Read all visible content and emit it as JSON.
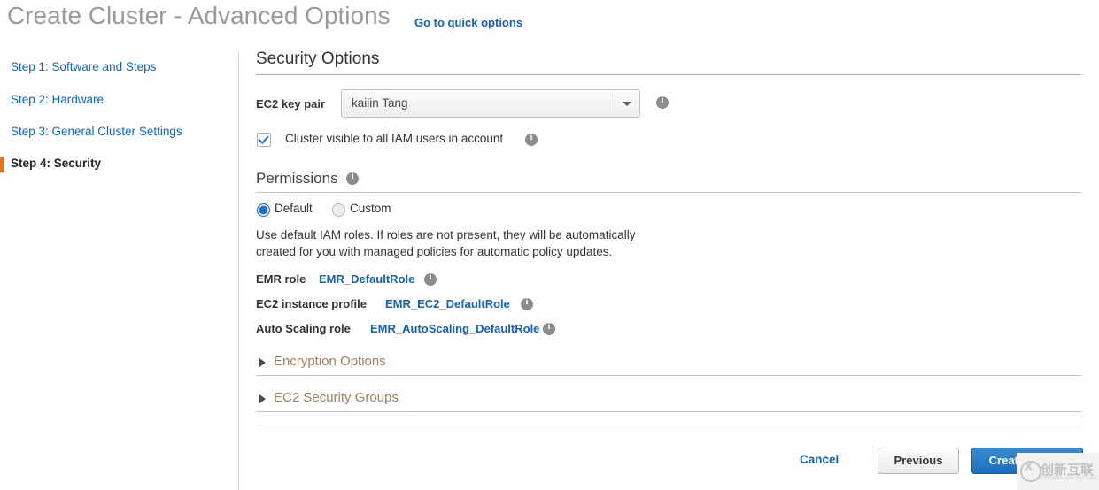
{
  "header": {
    "title": "Create Cluster - Advanced Options",
    "quick_options_link": "Go to quick options"
  },
  "sidebar": {
    "steps": [
      {
        "label": "Step 1: Software and Steps",
        "active": false
      },
      {
        "label": "Step 2: Hardware",
        "active": false
      },
      {
        "label": "Step 3: General Cluster Settings",
        "active": false
      },
      {
        "label": "Step 4: Security",
        "active": true
      }
    ],
    "active_marker_color": "#ec7211"
  },
  "main": {
    "section_title": "Security Options",
    "keypair": {
      "label": "EC2 key pair",
      "value": "kailin Tang",
      "options": [
        "kailin Tang"
      ]
    },
    "iam_visible": {
      "label": "Cluster visible to all IAM users in account",
      "checked": true
    },
    "permissions": {
      "title": "Permissions",
      "options": [
        {
          "label": "Default",
          "selected": true
        },
        {
          "label": "Custom",
          "selected": false
        }
      ],
      "description": "Use default IAM roles. If roles are not present, they will be automatically created for you with managed policies for automatic policy updates."
    },
    "roles": [
      {
        "label": "EMR role",
        "link": "EMR_DefaultRole"
      },
      {
        "label": "EC2 instance profile",
        "link": "EMR_EC2_DefaultRole"
      },
      {
        "label": "Auto Scaling role",
        "link": "EMR_AutoScaling_DefaultRole"
      }
    ],
    "collapsibles": [
      {
        "label": "Encryption Options",
        "expanded": false
      },
      {
        "label": "EC2 Security Groups",
        "expanded": false
      }
    ]
  },
  "footer": {
    "cancel_label": "Cancel",
    "previous_label": "Previous",
    "create_label": "Create cluster"
  },
  "watermark": {
    "chinese": "创新互联",
    "pinyin": "CHUANG XIN HU LIAN",
    "logo": "circled-x-logo"
  },
  "colors": {
    "link": "#0f62c4",
    "accent_orange": "#ec7211",
    "primary_button": "#1a6fbd",
    "collapsible_label": "#a57e5c"
  }
}
